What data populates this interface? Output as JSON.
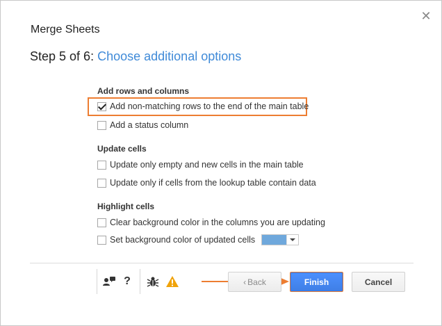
{
  "dialog": {
    "title": "Merge Sheets",
    "close_glyph": "✕",
    "step_prefix": "Step 5 of 6:",
    "step_title": "Choose additional options"
  },
  "sections": {
    "add_rows": {
      "heading": "Add rows and columns",
      "options": [
        {
          "label": "Add non-matching rows to the end of the main table",
          "checked": true
        },
        {
          "label": "Add a status column",
          "checked": false
        }
      ]
    },
    "update_cells": {
      "heading": "Update cells",
      "options": [
        {
          "label": "Update only empty and new cells in the main table",
          "checked": false
        },
        {
          "label": "Update only if cells from the lookup table contain data",
          "checked": false
        }
      ]
    },
    "highlight": {
      "heading": "Highlight cells",
      "options": [
        {
          "label": "Clear background color in the columns you are updating",
          "checked": false
        },
        {
          "label": "Set background color of updated cells",
          "checked": false
        }
      ],
      "selected_color": "#6fa8dc"
    }
  },
  "footer": {
    "help_glyph": "?",
    "icons": [
      "community-icon",
      "help-icon",
      "bug-icon",
      "warning-icon"
    ],
    "back_label": "Back",
    "back_glyph": "‹",
    "finish_label": "Finish",
    "cancel_label": "Cancel"
  },
  "colors": {
    "accent": "#3f8ad8",
    "highlight": "#ed7d31",
    "primary_button": "#4d90fe",
    "warning": "#f0a30a"
  }
}
